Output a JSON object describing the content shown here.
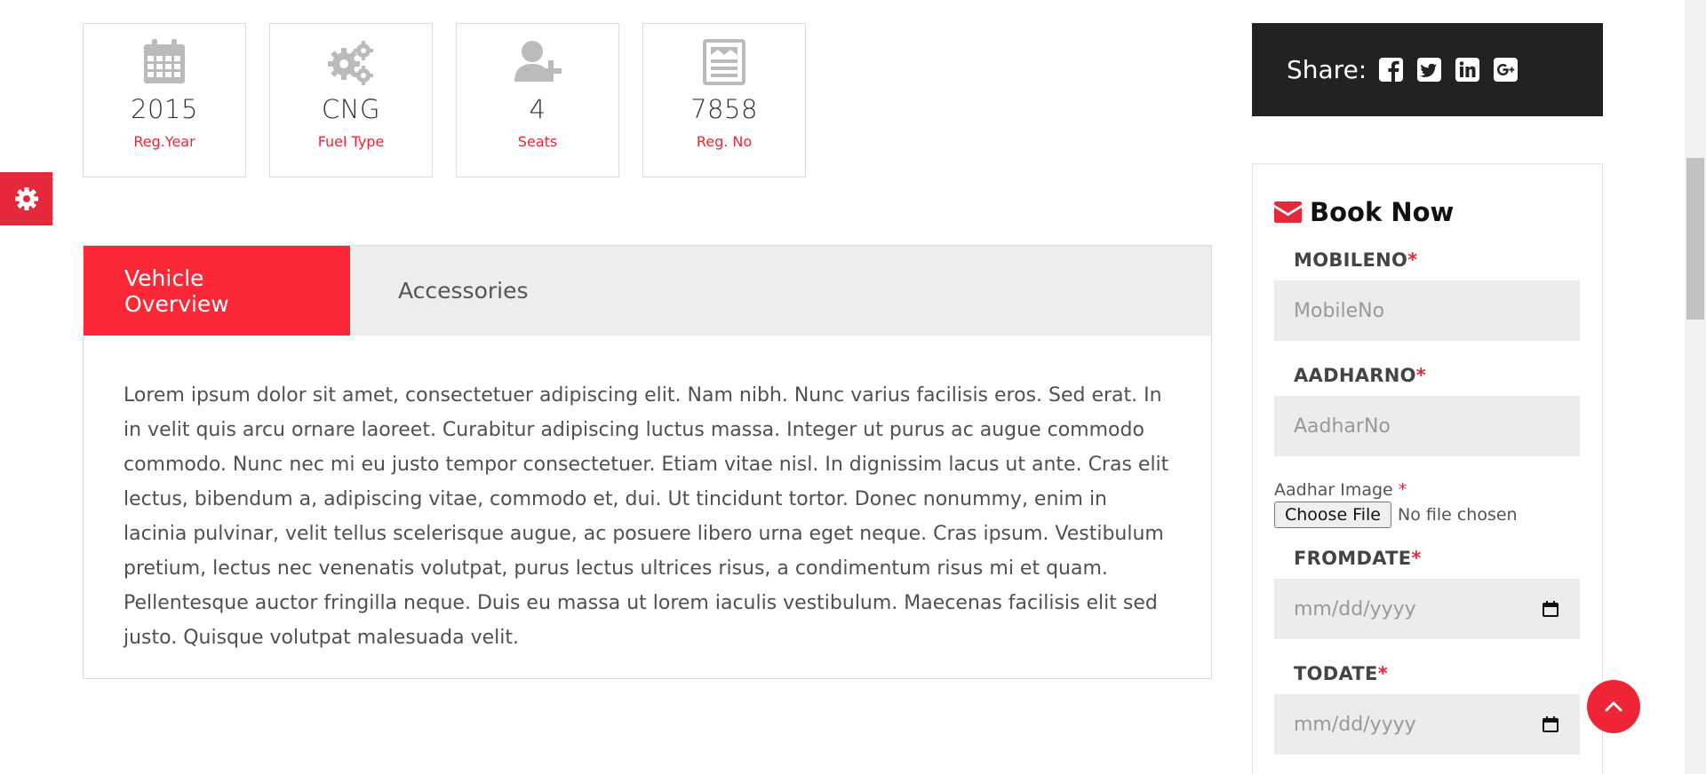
{
  "specs": [
    {
      "icon": "calendar-icon",
      "value": "2015",
      "label": "Reg.Year"
    },
    {
      "icon": "gears-icon",
      "value": "CNG",
      "label": "Fuel Type"
    },
    {
      "icon": "user-plus-icon",
      "value": "4",
      "label": "Seats"
    },
    {
      "icon": "newspaper-icon",
      "value": "7858",
      "label": "Reg. No"
    }
  ],
  "tabs": [
    {
      "label": "Vehicle Overview",
      "active": true
    },
    {
      "label": "Accessories",
      "active": false
    }
  ],
  "overview_text": "Lorem ipsum dolor sit amet, consectetuer adipiscing elit. Nam nibh. Nunc varius facilisis eros. Sed erat. In in velit quis arcu ornare laoreet. Curabitur adipiscing luctus massa. Integer ut purus ac augue commodo commodo. Nunc nec mi eu justo tempor consectetuer. Etiam vitae nisl. In dignissim lacus ut ante. Cras elit lectus, bibendum a, adipiscing vitae, commodo et, dui. Ut tincidunt tortor. Donec nonummy, enim in lacinia pulvinar, velit tellus scelerisque augue, ac posuere libero urna eget neque. Cras ipsum. Vestibulum pretium, lectus nec venenatis volutpat, purus lectus ultrices risus, a condimentum risus mi et quam. Pellentesque auctor fringilla neque. Duis eu massa ut lorem iaculis vestibulum. Maecenas facilisis elit sed justo. Quisque volutpat malesuada velit.",
  "share": {
    "label": "Share:",
    "icons": [
      "facebook-icon",
      "twitter-icon",
      "linkedin-icon",
      "google-plus-icon"
    ]
  },
  "booking": {
    "title": "Book Now",
    "required_mark": "*",
    "mobile_label": "MOBILENO",
    "mobile_placeholder": "MobileNo",
    "aadhar_no_label": "AADHARNO",
    "aadhar_no_placeholder": "AadharNo",
    "aadhar_image_label": "Aadhar Image",
    "file_button": "Choose File",
    "file_status": "No file chosen",
    "from_label": "FROMDATE",
    "from_placeholder": "mm/dd/yyyy",
    "to_label": "TODATE",
    "to_placeholder": "mm/dd/yyyy"
  },
  "colors": {
    "accent": "#fd2837",
    "dark": "#222222",
    "input_bg": "#ececec"
  }
}
